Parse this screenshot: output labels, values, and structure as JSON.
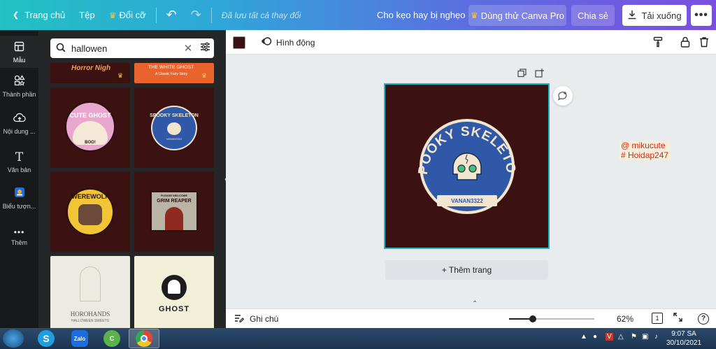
{
  "topbar": {
    "home": "Trang chủ",
    "file": "Tệp",
    "resize": "Đổi cỡ",
    "saved_status": "Đã lưu tất cả thay đổi",
    "doc_title": "Cho kẹo hay bị nghẹo",
    "try_pro": "Dùng thử Canva Pro",
    "share": "Chia sẻ",
    "download": "Tải xuống",
    "more": "•••"
  },
  "rail": [
    {
      "label": "Mẫu",
      "icon": "template-icon"
    },
    {
      "label": "Thành phần",
      "icon": "elements-icon"
    },
    {
      "label": "Nội dung ...",
      "icon": "upload-icon"
    },
    {
      "label": "Văn bản",
      "icon": "text-icon"
    },
    {
      "label": "Biểu tượn...",
      "icon": "logo-icon"
    },
    {
      "label": "Thêm",
      "icon": "more-icon"
    }
  ],
  "search": {
    "value": "hallowen"
  },
  "tiles": [
    {
      "line1": "Horror Nigh",
      "line2": ""
    },
    {
      "line1": "THE WHITE GHOST",
      "line2": "A Classic Fairy Story"
    },
    {
      "line1": "CUTE GHOST",
      "line2": "BOO!"
    },
    {
      "line1": "SPOOKY SKELETON",
      "line2": "VANAN3322"
    },
    {
      "line1": "WEREWOLF",
      "line2": ""
    },
    {
      "line1": "PLEASE WELCOME",
      "line2": "GRIM REAPER"
    },
    {
      "line1": "HOROHANDS",
      "line2": "HALLOWEEN SWEETS"
    },
    {
      "line1": "GHOST",
      "line2": ""
    }
  ],
  "editor": {
    "animate": "Hình động",
    "design_color": "#3b1111",
    "accent": "#1fb8c9"
  },
  "design": {
    "title": "SPOOKY SKELETON",
    "subtitle": "VANAN3322"
  },
  "canvas": {
    "add_page": "+ Thêm trang",
    "watermark_line1": "@ mikucute",
    "watermark_line2": "# Hoidap247"
  },
  "bottom": {
    "notes": "Ghi chú",
    "zoom_value": "62%",
    "zoom_level": 0.62,
    "page_count": "1",
    "help": "?"
  },
  "taskbar": {
    "apps": [
      "Skype",
      "Zalo",
      "CCleaner",
      "Chrome"
    ],
    "time": "9:07 SA",
    "date": "30/10/2021"
  }
}
